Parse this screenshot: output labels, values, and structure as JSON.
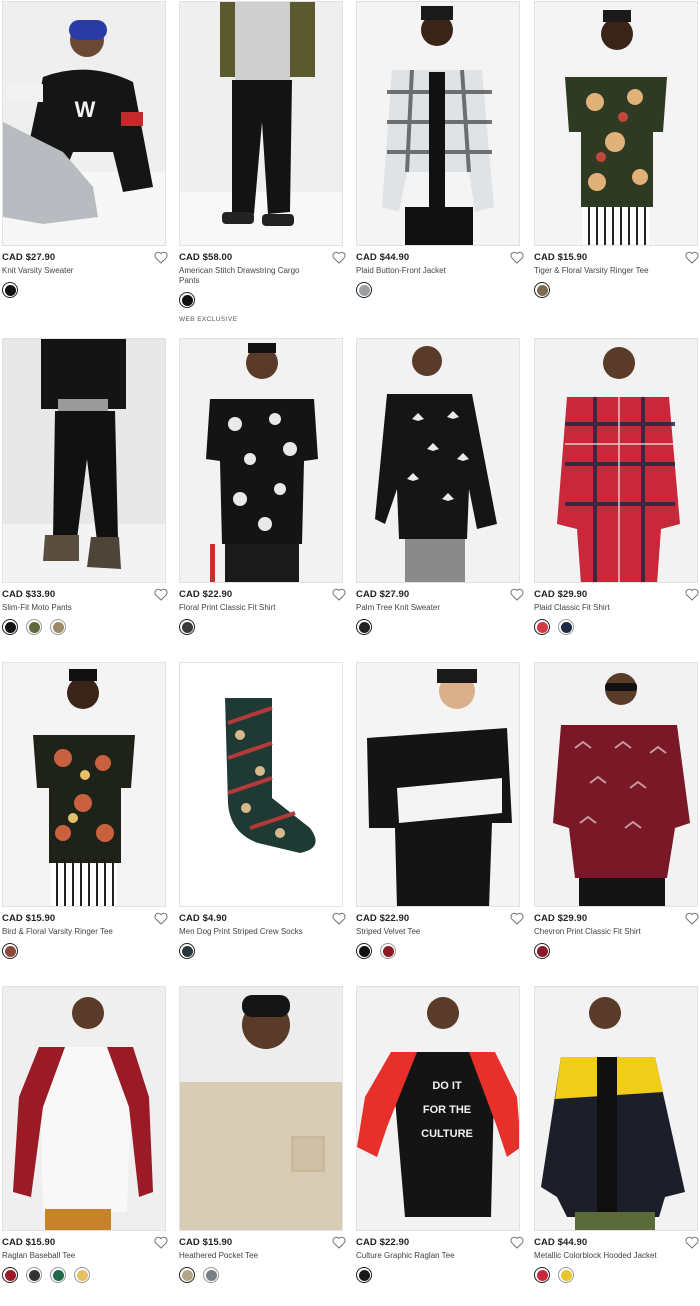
{
  "products": [
    {
      "price": "CAD $27.90",
      "name": "Knit Varsity Sweater",
      "swatches": [
        "#111111"
      ],
      "badge": ""
    },
    {
      "price": "CAD $58.00",
      "name": "American Stitch Drawstring Cargo Pants",
      "swatches": [
        "#111111"
      ],
      "badge": "WEB EXCLUSIVE"
    },
    {
      "price": "CAD $44.90",
      "name": "Plaid Button-Front Jacket",
      "swatches": [
        "#9a9fa3"
      ],
      "badge": ""
    },
    {
      "price": "CAD $15.90",
      "name": "Tiger & Floral Varsity Ringer Tee",
      "swatches": [
        "#7d6a52"
      ],
      "badge": ""
    },
    {
      "price": "CAD $33.90",
      "name": "Slim-Fit Moto Pants",
      "swatches": [
        "#111111",
        "#5d6a3a",
        "#a08a66"
      ],
      "badge": ""
    },
    {
      "price": "CAD $22.90",
      "name": "Floral Print Classic Fit Shirt",
      "swatches": [
        "#3a3a3a"
      ],
      "badge": ""
    },
    {
      "price": "CAD $27.90",
      "name": "Palm Tree Knit Sweater",
      "swatches": [
        "#222222"
      ],
      "badge": ""
    },
    {
      "price": "CAD $29.90",
      "name": "Plaid Classic Fit Shirt",
      "swatches": [
        "#d23a44",
        "#1e2a44"
      ],
      "badge": ""
    },
    {
      "price": "CAD $15.90",
      "name": "Bird & Floral Varsity Ringer Tee",
      "swatches": [
        "#8a4a3a"
      ],
      "badge": ""
    },
    {
      "price": "CAD $4.90",
      "name": "Men Dog Print Striped Crew Socks",
      "swatches": [
        "#2a3a3a"
      ],
      "badge": ""
    },
    {
      "price": "CAD $22.90",
      "name": "Striped Velvet Tee",
      "swatches": [
        "#111111",
        "#8a1a26"
      ],
      "badge": ""
    },
    {
      "price": "CAD $29.90",
      "name": "Chevron Print Classic Fit Shirt",
      "swatches": [
        "#8a1a2a"
      ],
      "badge": ""
    },
    {
      "price": "CAD $15.90",
      "name": "Raglan Baseball Tee",
      "swatches": [
        "#9a1a26",
        "#333333",
        "#1e6a4a",
        "#e8c060"
      ],
      "badge": ""
    },
    {
      "price": "CAD $15.90",
      "name": "Heathered Pocket Tee",
      "swatches": [
        "#b5a58a",
        "#7a8088"
      ],
      "badge": ""
    },
    {
      "price": "CAD $22.90",
      "name": "Culture Graphic Raglan Tee",
      "swatches": [
        "#1a1a1a"
      ],
      "badge": ""
    },
    {
      "price": "CAD $44.90",
      "name": "Metallic Colorblock Hooded Jacket",
      "swatches": [
        "#c8283a",
        "#e8c52a"
      ],
      "badge": ""
    }
  ],
  "graphics": {
    "culture_tee_text": [
      "DO IT",
      "FOR THE",
      "CULTURE"
    ],
    "sweater_letter": "W"
  },
  "icons": {
    "favorite": "heart-outline-icon"
  },
  "colors": {
    "text": "#222222",
    "muted": "#444444",
    "photo_bg": "#ececec"
  }
}
